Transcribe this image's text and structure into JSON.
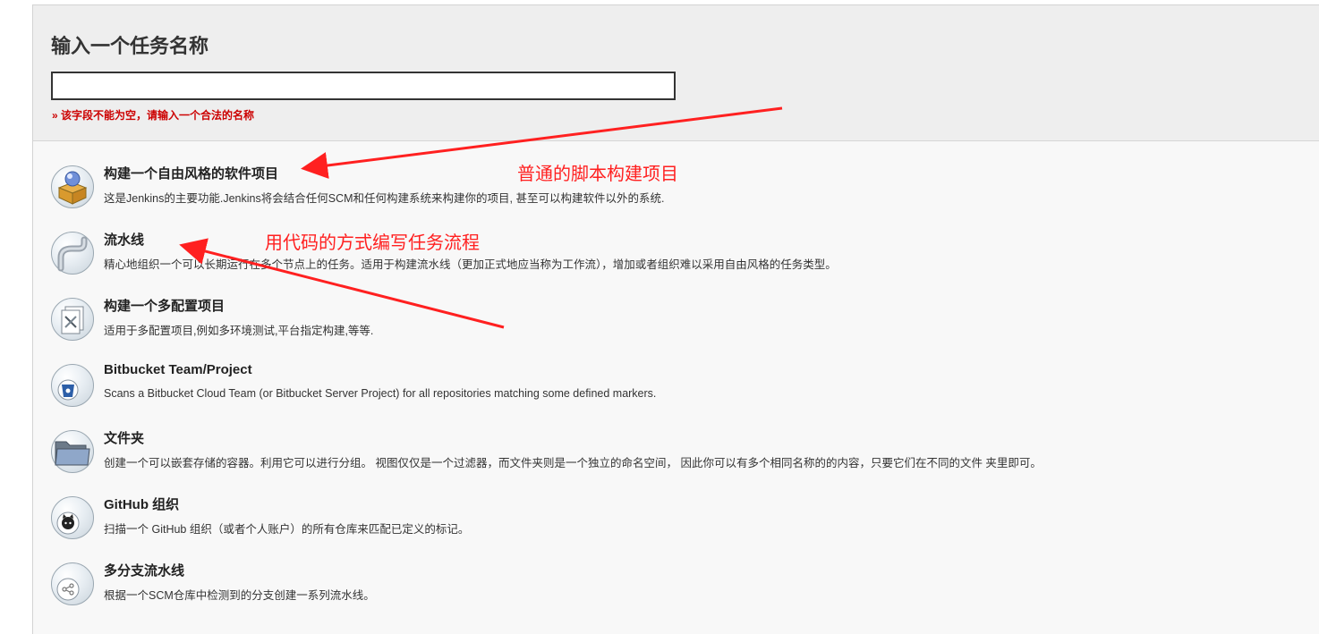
{
  "header": {
    "title": "输入一个任务名称",
    "name_input_value": "",
    "error_message": "» 该字段不能为空，请输入一个合法的名称"
  },
  "items": [
    {
      "title": "构建一个自由风格的软件项目",
      "description": "这是Jenkins的主要功能.Jenkins将会结合任何SCM和任何构建系统来构建你的项目, 甚至可以构建软件以外的系统.",
      "icon": "freestyle-project-icon"
    },
    {
      "title": "流水线",
      "description": "精心地组织一个可以长期运行在多个节点上的任务。适用于构建流水线（更加正式地应当称为工作流），增加或者组织难以采用自由风格的任务类型。",
      "icon": "pipeline-icon"
    },
    {
      "title": "构建一个多配置项目",
      "description": "适用于多配置项目,例如多环境测试,平台指定构建,等等.",
      "icon": "multi-config-project-icon"
    },
    {
      "title": "Bitbucket Team/Project",
      "description": "Scans a Bitbucket Cloud Team (or Bitbucket Server Project) for all repositories matching some defined markers.",
      "icon": "bitbucket-icon"
    },
    {
      "title": "文件夹",
      "description": "创建一个可以嵌套存储的容器。利用它可以进行分组。 视图仅仅是一个过滤器，而文件夹则是一个独立的命名空间， 因此你可以有多个相同名称的的内容，只要它们在不同的文件 夹里即可。",
      "icon": "folder-icon"
    },
    {
      "title": "GitHub 组织",
      "description": "扫描一个 GitHub 组织（或者个人账户）的所有仓库来匹配已定义的标记。",
      "icon": "github-icon"
    },
    {
      "title": "多分支流水线",
      "description": "根据一个SCM仓库中检测到的分支创建一系列流水线。",
      "icon": "multibranch-pipeline-icon"
    }
  ],
  "annotations": {
    "freestyle_note": "普通的脚本构建项目",
    "pipeline_note": "用代码的方式编写任务流程",
    "color": "#ff2020"
  }
}
